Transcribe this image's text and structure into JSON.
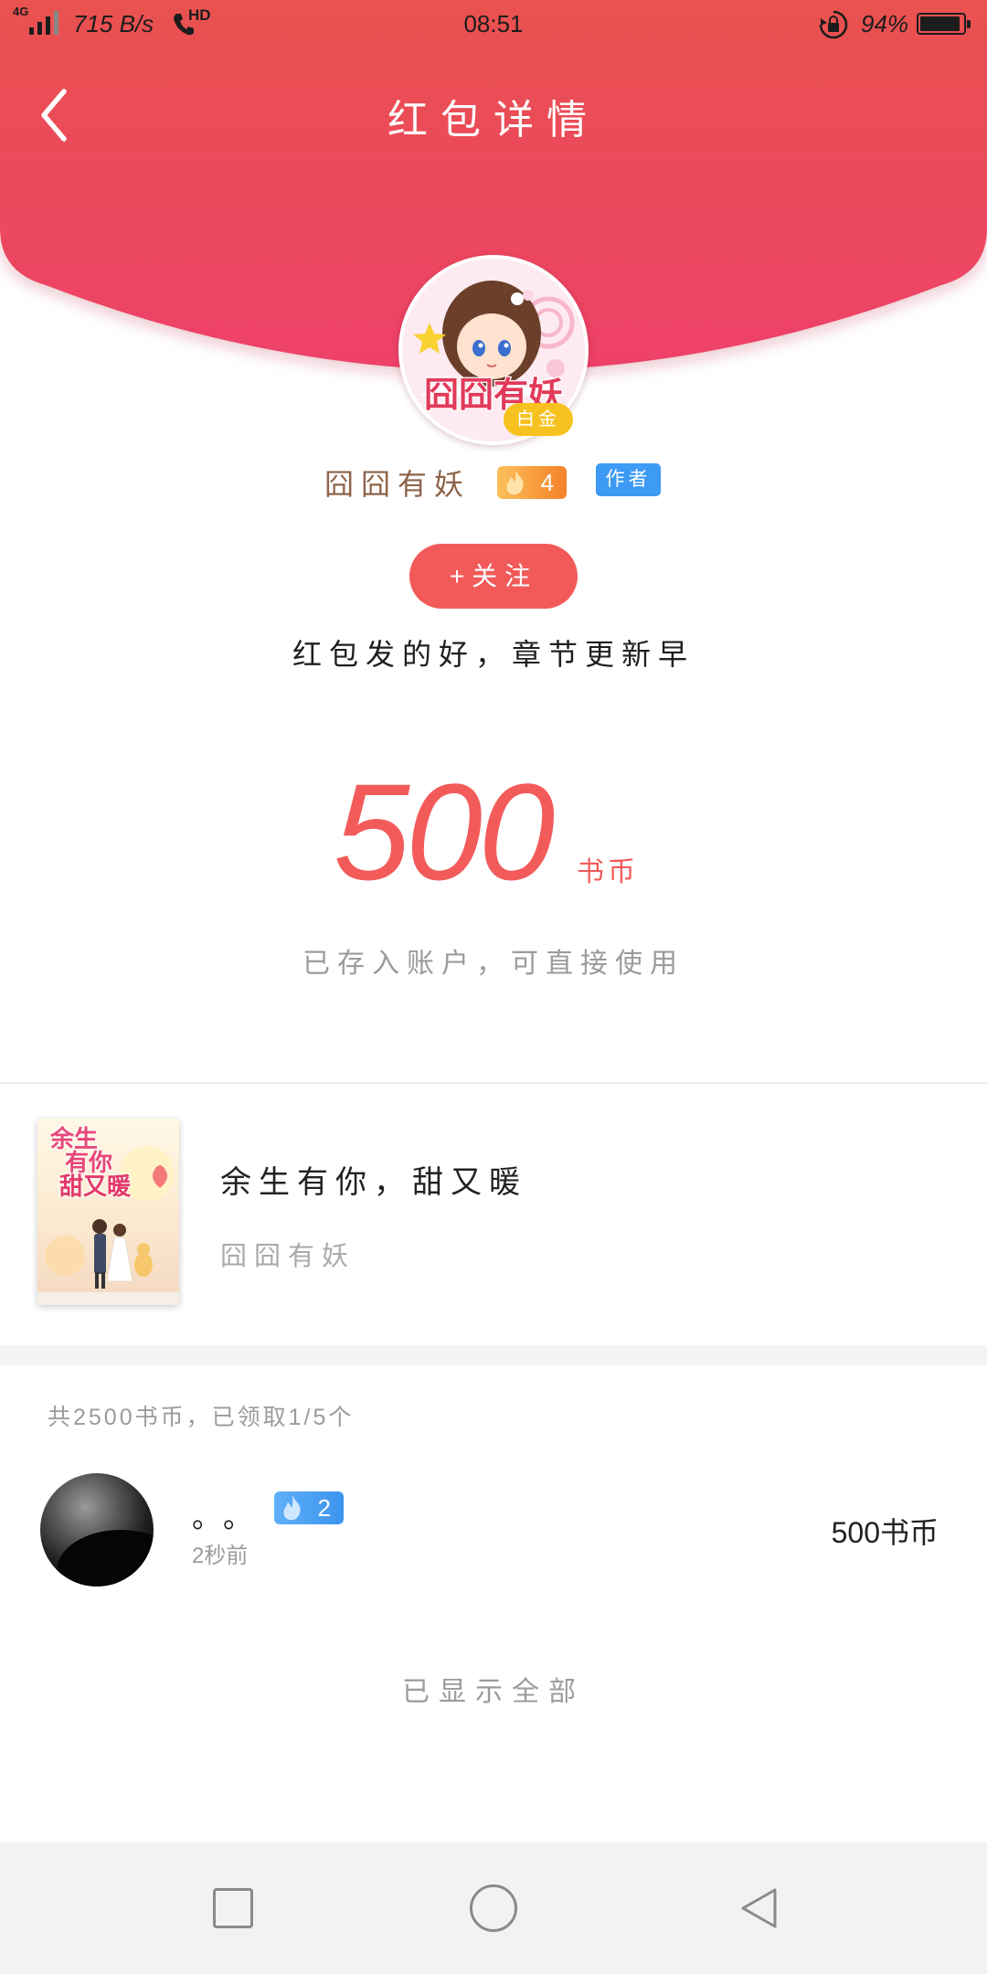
{
  "status_bar": {
    "network": "4G",
    "speed": "715 B/s",
    "hd": "HD",
    "time": "08:51",
    "battery": "94%",
    "icons": [
      "signal-icon",
      "hd-call-icon",
      "rotation-lock-icon",
      "battery-icon"
    ]
  },
  "header": {
    "title": "红包详情",
    "back_icon": "chevron-left-icon"
  },
  "sender": {
    "avatar_lettering": "囧囧有妖",
    "tier_badge": "白金",
    "name": "囧囧有妖",
    "level": "4",
    "role_tag": "作者",
    "follow_label": "+关注",
    "message": "红包发的好，章节更新早"
  },
  "reward": {
    "amount": "500",
    "unit": "书币",
    "note": "已存入账户，可直接使用"
  },
  "book": {
    "cover_lines": [
      "余生",
      "有你",
      "甜又暖"
    ],
    "title": "余生有你，甜又暖",
    "author": "囧囧有妖"
  },
  "claims": {
    "summary": "共2500书币，已领取1/5个",
    "records": [
      {
        "name": "。。",
        "level": "2",
        "time": "2秒前",
        "amount": "500书币"
      }
    ],
    "footer": "已显示全部"
  },
  "nav_bar": {
    "icons": [
      "recent-apps-icon",
      "home-icon",
      "back-icon"
    ]
  },
  "colors": {
    "header_top": "#e9524f",
    "header_bottom": "#ee4169",
    "accent": "#f25a5a",
    "amount": "#f35b5b",
    "tier": "#f7c21f",
    "role": "#3d9af5"
  }
}
